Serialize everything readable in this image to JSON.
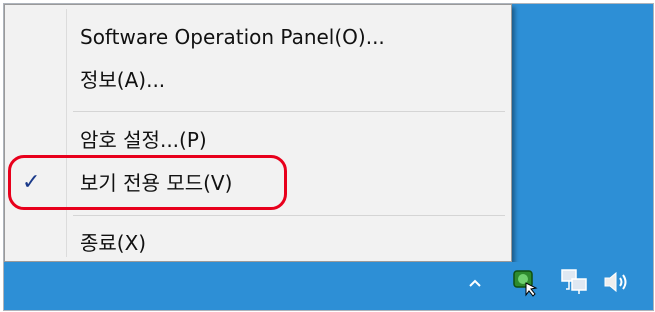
{
  "menu": {
    "items": [
      {
        "label": "Software Operation Panel(O)..."
      },
      {
        "label": "정보(A)..."
      },
      {
        "label": "암호 설정...(P)"
      },
      {
        "label": "보기 전용 모드(V)",
        "checked": true,
        "check_glyph": "✓"
      },
      {
        "label": "종료(X)"
      }
    ]
  },
  "tray": {
    "icons": [
      "chevron-up-icon",
      "scanner-tray-icon",
      "network-icon",
      "speaker-icon"
    ]
  },
  "colors": {
    "highlight": "#e8001c",
    "taskbar": "#2d8fd6",
    "menu_bg": "#f2f2f2"
  }
}
